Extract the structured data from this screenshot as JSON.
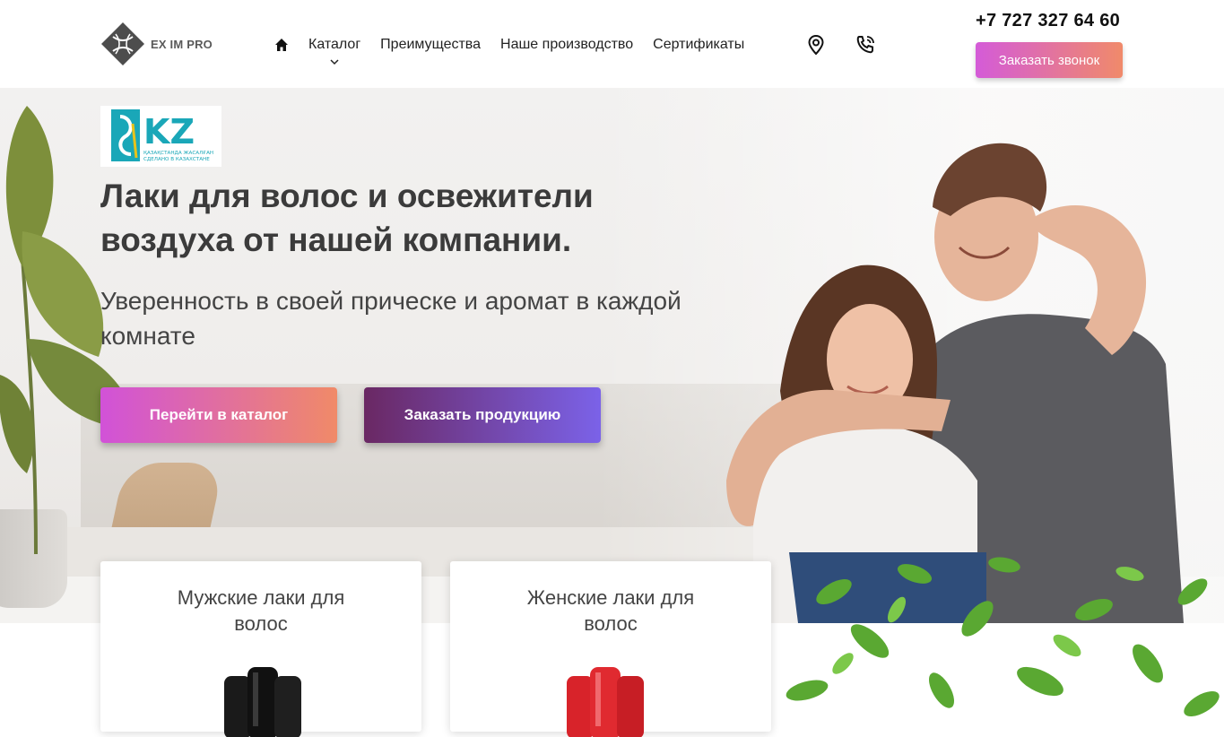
{
  "header": {
    "logo_text": "EX IM PRO",
    "nav": [
      {
        "label": "Каталог"
      },
      {
        "label": "Преимущества"
      },
      {
        "label": "Наше производство"
      },
      {
        "label": "Сертификаты"
      }
    ],
    "phone": "+7 727 327 64 60",
    "callback_label": "Заказать звонок"
  },
  "hero": {
    "badge": {
      "letters": "KZ",
      "line1": "ҚАЗАҚСТАНДА ЖАСАЛҒАН",
      "line2": "СДЕЛАНО В КАЗАХСТАНЕ"
    },
    "title": "Лаки для волос и освежители воздуха от нашей компании.",
    "subtitle": "Уверенность в своей прическе и аромат в каждой комнате",
    "catalog_button": "Перейти в каталог",
    "order_button": "Заказать продукцию"
  },
  "cards": [
    {
      "title": "Мужские лаки для волос",
      "can_color": "#1a1a1a"
    },
    {
      "title": "Женские лаки для волос",
      "can_color": "#d8232a"
    }
  ],
  "colors": {
    "accent_gradient_start": "#d45bd8",
    "accent_gradient_end": "#f08a6a",
    "order_gradient_start": "#6a2863",
    "order_gradient_end": "#7b62e8",
    "badge_teal": "#1aa7b8"
  }
}
